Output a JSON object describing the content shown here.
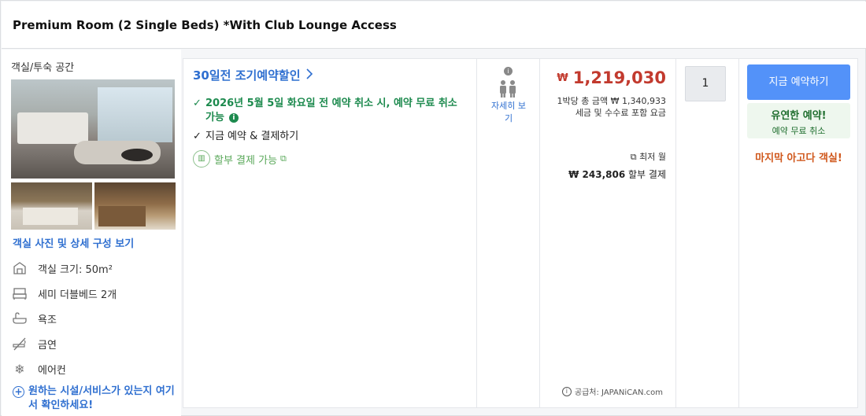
{
  "room": {
    "title": "Premium Room (2 Single Beds) *With Club Lounge Access"
  },
  "left": {
    "category": "객실/투숙 공간",
    "view_photos": "객실 사진 및 상세 구성 보기",
    "amenities": [
      {
        "icon": "room-size-icon",
        "label": "객실 크기: 50m²"
      },
      {
        "icon": "bed-icon",
        "label": "세미 더블베드 2개"
      },
      {
        "icon": "bathtub-icon",
        "label": "욕조"
      },
      {
        "icon": "no-smoking-icon",
        "label": "금연"
      },
      {
        "icon": "snowflake-icon",
        "label": "에어컨"
      }
    ],
    "more_link": "원하는 시설/서비스가 있는지 여기서 확인하세요!"
  },
  "offer": {
    "promo": "30일전 조기예약할인",
    "free_cancel": "2026년 5월 5일 화요일 전 예약 취소 시, 예약 무료 취소 가능",
    "pay_now": "지금 예약 & 결제하기",
    "installment": "할부 결제 가능"
  },
  "occupancy": {
    "detail_label": "자세히 보기"
  },
  "price": {
    "currency": "₩",
    "amount": "1,219,030",
    "total_line": "1박당 총 금액 ₩ 1,340,933",
    "tax_line": "세금 및 수수료 포함 요금",
    "monthly_label": "최저 월",
    "monthly_amount": "₩ 243,806",
    "monthly_suffix": "할부 결제",
    "supplier": "공급처: JAPANiCAN.com"
  },
  "quantity": {
    "value": "1"
  },
  "booking": {
    "button": "지금 예약하기",
    "flex_title": "유연한 예약!",
    "flex_sub": "예약 무료 취소",
    "last_room": "마지막 아고다 객실!"
  },
  "colors": {
    "link": "#2f6fd0",
    "price": "#c23a2e",
    "button": "#5392f9",
    "green": "#1d8a4e",
    "urgency": "#d0571b"
  }
}
